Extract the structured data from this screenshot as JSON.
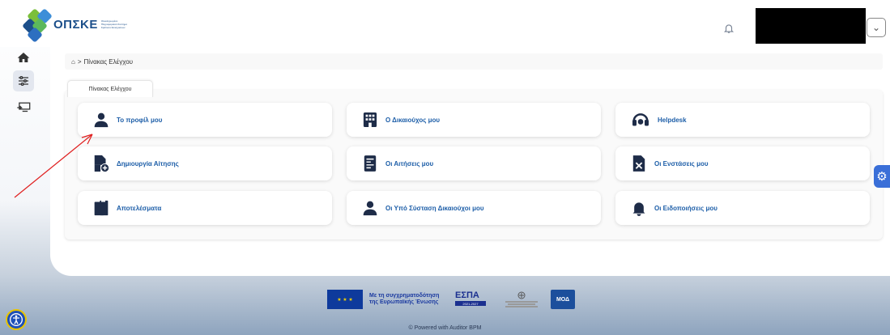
{
  "header": {
    "logo_text": "ΟΠΣΚΕ",
    "logo_subtitle": "Ολοκληρωμένο Πληροφοριακό Σύστημα Κρατικών Ενισχύσεων",
    "bell_icon": "bell-icon",
    "dropdown_icon": "chevron-down-icon"
  },
  "sidebar": {
    "items": [
      {
        "icon": "home-icon"
      },
      {
        "icon": "sliders-icon"
      },
      {
        "icon": "monitor-switch-icon"
      }
    ]
  },
  "breadcrumb": {
    "home_icon": "home-icon",
    "separator": ">",
    "current": "Πίνακας Ελέγχου"
  },
  "tab": {
    "label": "Πίνακας Ελέγχου"
  },
  "cards": [
    {
      "label": "Το προφίλ μου",
      "icon": "user-icon"
    },
    {
      "label": "Ο Δικαιούχος μου",
      "icon": "building-icon"
    },
    {
      "label": "Helpdesk",
      "icon": "headset-icon"
    },
    {
      "label": "Δημιουργία Αίτησης",
      "icon": "file-add-icon"
    },
    {
      "label": "Οι Αιτήσεις μου",
      "icon": "document-list-icon"
    },
    {
      "label": "Οι Ενστάσεις μου",
      "icon": "file-x-icon"
    },
    {
      "label": "Αποτελέσματα",
      "icon": "clipboard-icon"
    },
    {
      "label": "Οι Υπό Σύσταση Δικαιούχοι μου",
      "icon": "user-icon"
    },
    {
      "label": "Οι Ειδοποιήσεις μου",
      "icon": "bell-icon"
    }
  ],
  "footer": {
    "eu_text_line1": "Με τη συγχρηματοδότηση",
    "eu_text_line2": "της Ευρωπαϊκής Ένωσης",
    "espa_title": "ΕΣΠΑ",
    "espa_years": "2021-2027",
    "moa_text": "ΜΟΔ",
    "powered_by": "© Powered with Auditor BPM"
  },
  "colors": {
    "accent": "#1d5ea8",
    "gear_tab": "#3a6fd8",
    "logo_green": "#7bbf3a",
    "logo_blue": "#1c4f8a"
  },
  "accessibility_icon": "accessibility-icon",
  "settings_icon": "gear-icon"
}
